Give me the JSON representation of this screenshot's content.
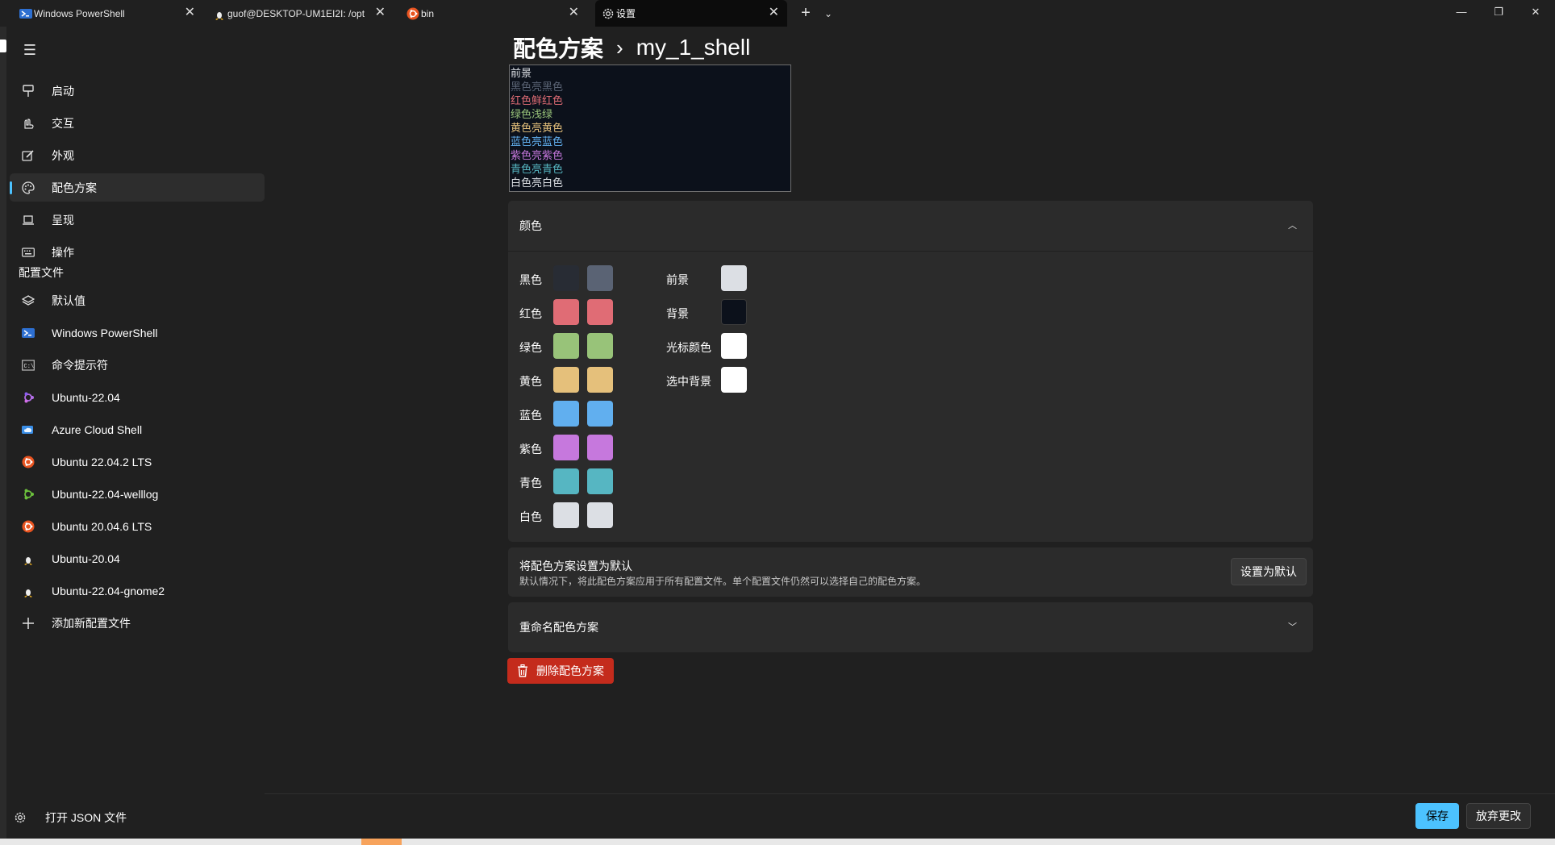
{
  "tabs": [
    {
      "title": "Windows PowerShell",
      "icon": "powershell-icon"
    },
    {
      "title": "guof@DESKTOP-UM1EI2I: /opt",
      "icon": "linux-tux-icon"
    },
    {
      "title": "bin",
      "icon": "ubuntu-icon"
    },
    {
      "title": "设置",
      "icon": "gear-icon",
      "active": true
    }
  ],
  "tab_controls": {
    "new_tab": "+",
    "dropdown": "⌄"
  },
  "window_controls": {
    "minimize": "—",
    "restore": "❐",
    "close": "✕"
  },
  "sidebar": {
    "hamburger": "☰",
    "items": [
      {
        "label": "启动",
        "icon": "startup-icon"
      },
      {
        "label": "交互",
        "icon": "interaction-icon"
      },
      {
        "label": "外观",
        "icon": "appearance-icon"
      },
      {
        "label": "配色方案",
        "icon": "palette-icon",
        "selected": true
      },
      {
        "label": "呈现",
        "icon": "rendering-icon"
      },
      {
        "label": "操作",
        "icon": "keyboard-icon"
      }
    ],
    "profiles_header": "配置文件",
    "profiles": [
      {
        "label": "默认值",
        "icon": "layers-icon"
      },
      {
        "label": "Windows PowerShell",
        "icon": "powershell-icon"
      },
      {
        "label": "命令提示符",
        "icon": "cmd-icon"
      },
      {
        "label": "Ubuntu-22.04",
        "icon": "ubuntu-purple-icon"
      },
      {
        "label": "Azure Cloud Shell",
        "icon": "azure-cloud-icon"
      },
      {
        "label": "Ubuntu 22.04.2 LTS",
        "icon": "ubuntu-icon"
      },
      {
        "label": "Ubuntu-22.04-welllog",
        "icon": "green-ubuntu-icon"
      },
      {
        "label": "Ubuntu 20.04.6 LTS",
        "icon": "ubuntu-icon"
      },
      {
        "label": "Ubuntu-20.04",
        "icon": "linux-tux-icon"
      },
      {
        "label": "Ubuntu-22.04-gnome2",
        "icon": "linux-tux-icon"
      },
      {
        "label": "添加新配置文件",
        "icon": "plus-icon"
      }
    ],
    "open_json": "打开 JSON 文件"
  },
  "breadcrumb": {
    "parent": "配色方案",
    "separator": "›",
    "current": "my_1_shell"
  },
  "preview": {
    "lines": [
      {
        "text": "前景",
        "color": "#dcdfe4"
      },
      {
        "text": "黑色亮黑色",
        "color": "#5a6374"
      },
      {
        "text": "红色鲜红色",
        "color": "#e06c75"
      },
      {
        "text": "绿色浅绿",
        "color": "#98c379"
      },
      {
        "text": "黄色亮黄色",
        "color": "#e5c07b"
      },
      {
        "text": "蓝色亮蓝色",
        "color": "#61afef"
      },
      {
        "text": "紫色亮紫色",
        "color": "#c678dd"
      },
      {
        "text": "青色亮青色",
        "color": "#56b6c2"
      },
      {
        "text": "白色亮白色",
        "color": "#dcdfe4"
      }
    ]
  },
  "colors_section": {
    "title": "颜色",
    "rows": [
      {
        "label": "黑色",
        "normal": "#282c34",
        "bright": "#5a6374"
      },
      {
        "label": "红色",
        "normal": "#e06c75",
        "bright": "#e06c75"
      },
      {
        "label": "绿色",
        "normal": "#98c379",
        "bright": "#98c379"
      },
      {
        "label": "黄色",
        "normal": "#e5c07b",
        "bright": "#e5c07b"
      },
      {
        "label": "蓝色",
        "normal": "#61afef",
        "bright": "#61afef"
      },
      {
        "label": "紫色",
        "normal": "#c678dd",
        "bright": "#c678dd"
      },
      {
        "label": "青色",
        "normal": "#56b6c2",
        "bright": "#56b6c2"
      },
      {
        "label": "白色",
        "normal": "#dcdfe4",
        "bright": "#dcdfe4"
      }
    ],
    "special": [
      {
        "label": "前景",
        "color": "#dcdfe4"
      },
      {
        "label": "背景",
        "color": "#0c111b"
      },
      {
        "label": "光标颜色",
        "color": "#ffffff"
      },
      {
        "label": "选中背景",
        "color": "#ffffff"
      }
    ]
  },
  "set_default": {
    "title": "将配色方案设置为默认",
    "description": "默认情况下，将此配色方案应用于所有配置文件。单个配置文件仍然可以选择自己的配色方案。",
    "button": "设置为默认"
  },
  "rename": {
    "title": "重命名配色方案"
  },
  "delete_button": "删除配色方案",
  "footer": {
    "save": "保存",
    "discard": "放弃更改"
  },
  "accent_colors": {
    "primary": "#4cc2ff",
    "danger": "#c42b1c"
  }
}
